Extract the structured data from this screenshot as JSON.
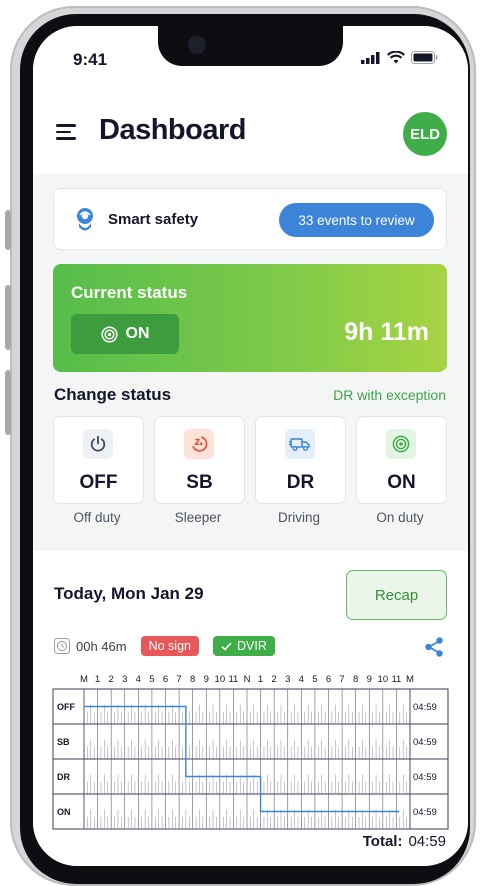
{
  "statusbar": {
    "time": "9:41"
  },
  "header": {
    "title": "Dashboard",
    "avatar": "ELD"
  },
  "safety": {
    "label": "Smart safety",
    "events_button": "33 events to review"
  },
  "current_status": {
    "title": "Current status",
    "status": "ON",
    "duration": "9h 11m"
  },
  "change_status": {
    "title": "Change status",
    "exception": "DR with exception",
    "options": [
      {
        "code": "OFF",
        "label": "Off duty",
        "icon": "power-icon",
        "color": "#3e4a60"
      },
      {
        "code": "SB",
        "label": "Sleeper",
        "icon": "sleeper-icon",
        "color": "#e0573b"
      },
      {
        "code": "DR",
        "label": "Driving",
        "icon": "truck-icon",
        "color": "#3c84d8"
      },
      {
        "code": "ON",
        "label": "On duty",
        "icon": "target-icon",
        "color": "#3fae49"
      }
    ]
  },
  "log": {
    "date": "Today, Mon Jan 29",
    "recap": "Recap",
    "timer": "00h 46m",
    "no_sign": "No sign",
    "dvir": "DVIR",
    "hour_labels": [
      "M",
      "1",
      "2",
      "3",
      "4",
      "5",
      "6",
      "7",
      "8",
      "9",
      "10",
      "11",
      "N",
      "1",
      "2",
      "3",
      "4",
      "5",
      "6",
      "7",
      "8",
      "9",
      "10",
      "11",
      "M"
    ],
    "rows": [
      {
        "code": "OFF",
        "total": "04:59"
      },
      {
        "code": "SB",
        "total": "04:59"
      },
      {
        "code": "DR",
        "total": "04:59"
      },
      {
        "code": "ON",
        "total": "04:59"
      }
    ],
    "total_label": "Total:",
    "total_value": "04:59"
  },
  "colors": {
    "accent_green": "#3fae49",
    "accent_blue": "#3c84d8",
    "no_sign_red": "#e8575a",
    "log_line": "#3c84d8"
  }
}
